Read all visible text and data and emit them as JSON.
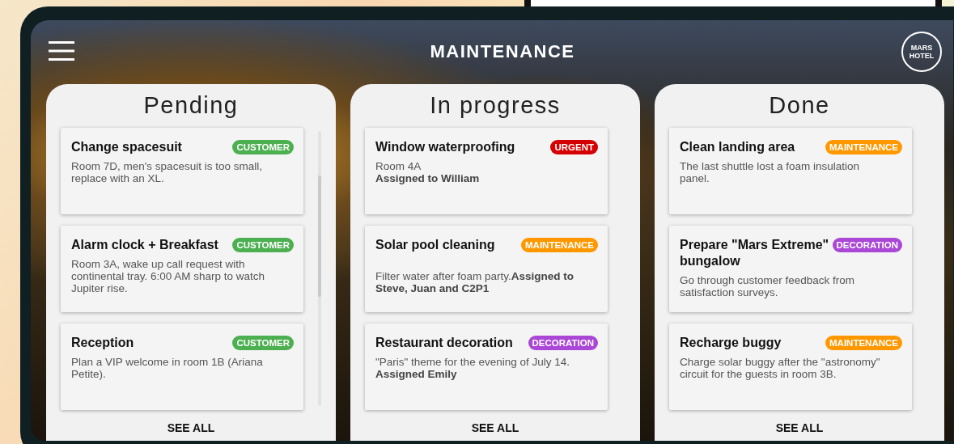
{
  "header": {
    "title": "MAINTENANCE",
    "logo_lines": [
      "MARS",
      "HOTEL"
    ]
  },
  "columns": [
    {
      "title": "Pending",
      "scrollable": true,
      "see_all": "SEE ALL",
      "cards": [
        {
          "title": "Change spacesuit",
          "tag": {
            "label": "CUSTOMER",
            "color": "#4caf50"
          },
          "text": "Room 7D, men's spacesuit is too small, replace with an XL."
        },
        {
          "title": "Alarm clock + Breakfast",
          "tag": {
            "label": "CUSTOMER",
            "color": "#4caf50"
          },
          "text": "Room 3A, wake up call request with continental tray. 6:00 AM sharp to watch Jupiter rise."
        },
        {
          "title": "Reception",
          "tag": {
            "label": "CUSTOMER",
            "color": "#4caf50"
          },
          "text": "Plan a VIP welcome in room 1B (Ariana Petite)."
        }
      ]
    },
    {
      "title": "In progress",
      "scrollable": false,
      "see_all": "SEE ALL",
      "cards": [
        {
          "title": "Window waterproofing",
          "tag": {
            "label": "URGENT",
            "color": "#d50000"
          },
          "text": "Room 4A\n**Assigned to William**"
        },
        {
          "title": "Solar pool cleaning",
          "tag": {
            "label": "MAINTENANCE",
            "color": "#ff9800"
          },
          "text": "\nFilter water after foam party.**Assigned to Steve, Juan and C2P1**"
        },
        {
          "title": "Restaurant decoration",
          "tag": {
            "label": "DECORATION",
            "color": "#ab47d6"
          },
          "text": "\"Paris\" theme for the evening of July 14.\n**Assigned Emily**"
        }
      ]
    },
    {
      "title": "Done",
      "scrollable": false,
      "see_all": "SEE ALL",
      "cards": [
        {
          "title": "Clean landing area",
          "tag": {
            "label": "MAINTENANCE",
            "color": "#ff9800"
          },
          "text": "The last shuttle lost a foam insulation panel."
        },
        {
          "title": "Prepare \"Mars Extreme\" bungalow",
          "tag": {
            "label": "DECORATION",
            "color": "#ab47d6"
          },
          "text": "Go through customer feedback from satisfaction surveys."
        },
        {
          "title": "Recharge buggy",
          "tag": {
            "label": "MAINTENANCE",
            "color": "#ff9800"
          },
          "text": "Charge solar buggy after the \"astronomy\" circuit for the guests in room 3B."
        }
      ]
    }
  ]
}
